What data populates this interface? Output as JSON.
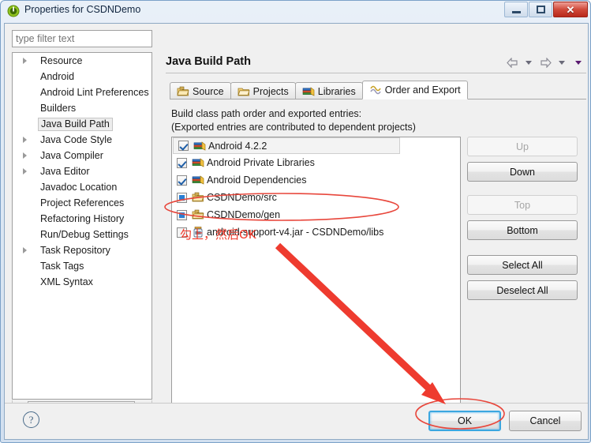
{
  "window": {
    "title": "Properties for CSDNDemo",
    "icon": "eclipse-properties-icon",
    "buttons": {
      "minimize": "minimize-icon",
      "maximize": "restore-icon",
      "close": "✕"
    }
  },
  "filter": {
    "placeholder": "type filter text",
    "value": ""
  },
  "sidebar": {
    "items": [
      {
        "label": "Resource",
        "expandable": true,
        "selected": false
      },
      {
        "label": "Android",
        "expandable": false,
        "selected": false
      },
      {
        "label": "Android Lint Preferences",
        "expandable": false,
        "selected": false
      },
      {
        "label": "Builders",
        "expandable": false,
        "selected": false
      },
      {
        "label": "Java Build Path",
        "expandable": false,
        "selected": true
      },
      {
        "label": "Java Code Style",
        "expandable": true,
        "selected": false
      },
      {
        "label": "Java Compiler",
        "expandable": true,
        "selected": false
      },
      {
        "label": "Java Editor",
        "expandable": true,
        "selected": false
      },
      {
        "label": "Javadoc Location",
        "expandable": false,
        "selected": false
      },
      {
        "label": "Project References",
        "expandable": false,
        "selected": false
      },
      {
        "label": "Refactoring History",
        "expandable": false,
        "selected": false
      },
      {
        "label": "Run/Debug Settings",
        "expandable": false,
        "selected": false
      },
      {
        "label": "Task Repository",
        "expandable": true,
        "selected": false
      },
      {
        "label": "Task Tags",
        "expandable": false,
        "selected": false
      },
      {
        "label": "XML Syntax",
        "expandable": false,
        "selected": false
      }
    ],
    "scrollbar": {
      "left_arrow": "◀",
      "right_arrow": "▶",
      "grip": "|||"
    }
  },
  "main": {
    "title": "Java Build Path",
    "nav": {
      "back": "back-arrow-icon",
      "back_dropdown": "chevron-down-icon",
      "forward": "forward-arrow-icon",
      "forward_dropdown": "chevron-down-icon",
      "menu_dropdown": "chevron-down-icon"
    },
    "tabs": [
      {
        "label": "Source",
        "icon": "source-folder-icon",
        "active": false
      },
      {
        "label": "Projects",
        "icon": "projects-folder-icon",
        "active": false
      },
      {
        "label": "Libraries",
        "icon": "libraries-books-icon",
        "active": false
      },
      {
        "label": "Order and Export",
        "icon": "order-export-icon",
        "active": true
      }
    ],
    "description_line1": "Build class path order and exported entries:",
    "description_line2": "(Exported entries are contributed to dependent projects)",
    "entries": [
      {
        "label": "Android 4.2.2",
        "checked": true,
        "checkstyle": "check",
        "icon": "libraries-books-icon",
        "highlighted": true
      },
      {
        "label": "Android Private Libraries",
        "checked": true,
        "checkstyle": "check",
        "icon": "libraries-books-icon",
        "highlighted": false
      },
      {
        "label": "Android Dependencies",
        "checked": true,
        "checkstyle": "check",
        "icon": "libraries-books-icon",
        "highlighted": false
      },
      {
        "label": "CSDNDemo/src",
        "checked": true,
        "checkstyle": "solid",
        "icon": "source-folder-icon",
        "highlighted": false
      },
      {
        "label": "CSDNDemo/gen",
        "checked": true,
        "checkstyle": "solid",
        "icon": "source-folder-icon",
        "highlighted": false
      },
      {
        "label": "android-support-v4.jar - CSDNDemo/libs",
        "checked": false,
        "checkstyle": "empty",
        "icon": "jar-icon",
        "highlighted": false
      }
    ],
    "side_buttons": [
      {
        "label": "Up",
        "enabled": false
      },
      {
        "label": "Down",
        "enabled": true
      },
      {
        "label": "Top",
        "enabled": false
      },
      {
        "label": "Bottom",
        "enabled": true
      },
      {
        "label": "Select All",
        "enabled": true
      },
      {
        "label": "Deselect All",
        "enabled": true
      }
    ]
  },
  "footer": {
    "help": "?",
    "ok": "OK",
    "cancel": "Cancel"
  },
  "annotations": {
    "text": "勾上，然后OK",
    "color": "#f0392b",
    "ellipse_target_entry": "android-support-v4.jar - CSDNDemo/libs",
    "ellipse_target_button": "OK",
    "arrow": "red-arrow-pointing-to-ok"
  }
}
